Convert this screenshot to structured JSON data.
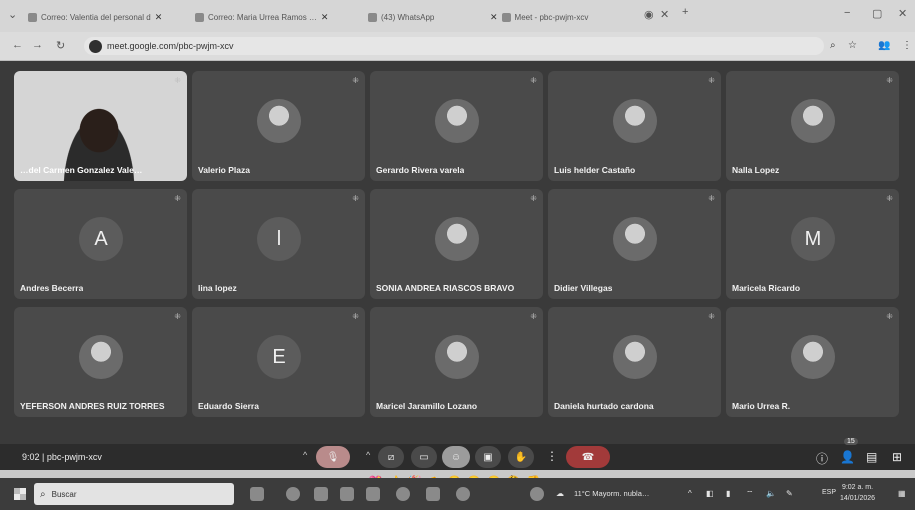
{
  "browser": {
    "tabs": [
      {
        "label": "Correo: Valentia del personal d"
      },
      {
        "label": "Correo: Maria Urrea Ramos …"
      },
      {
        "label": "(43) WhatsApp"
      },
      {
        "label": "Meet - pbc-pwjm-xcv"
      }
    ],
    "new_tab": "+",
    "window_controls": {
      "minimize": "−",
      "maximize": "▢",
      "close": "✕"
    },
    "url": "meet.google.com/pbc-pwjm-xcv"
  },
  "meet": {
    "participants": [
      {
        "name": "…del Carmen Gonzalez Vale…",
        "avatar": "video"
      },
      {
        "name": "Valerio Plaza",
        "avatar": "photo"
      },
      {
        "name": "Gerardo Rivera varela",
        "avatar": "photo"
      },
      {
        "name": "Luis helder Castaño",
        "avatar": "photo"
      },
      {
        "name": "Nalla Lopez",
        "avatar": "photo"
      },
      {
        "name": "Andres Becerra",
        "avatar": "letter",
        "letter": "A"
      },
      {
        "name": "lina lopez",
        "avatar": "letter",
        "letter": "l"
      },
      {
        "name": "SONIA ANDREA RIASCOS BRAVO",
        "avatar": "photo"
      },
      {
        "name": "Didier Villegas",
        "avatar": "photo"
      },
      {
        "name": "Maricela Ricardo",
        "avatar": "letter",
        "letter": "M"
      },
      {
        "name": "YEFERSON ANDRES RUIZ TORRES",
        "avatar": "photo"
      },
      {
        "name": "Eduardo Sierra",
        "avatar": "letter",
        "letter": "E"
      },
      {
        "name": "Maricel Jaramillo Lozano",
        "avatar": "photo"
      },
      {
        "name": "Daniela hurtado cardona",
        "avatar": "photo"
      },
      {
        "name": "Mario Urrea R.",
        "avatar": "photo"
      }
    ],
    "reactions": [
      "💖",
      "👍",
      "🎉",
      "👏",
      "😂",
      "😮",
      "😢",
      "🤔",
      "👎"
    ],
    "meeting_info": "9:02 | pbc-pwjm-xcv",
    "people_count": "15"
  },
  "taskbar": {
    "search_placeholder": "Buscar",
    "weather": "11°C Mayorm. nubla…",
    "language": "ESP",
    "time": "9:02 a. m.",
    "date": "14/01/2026"
  }
}
